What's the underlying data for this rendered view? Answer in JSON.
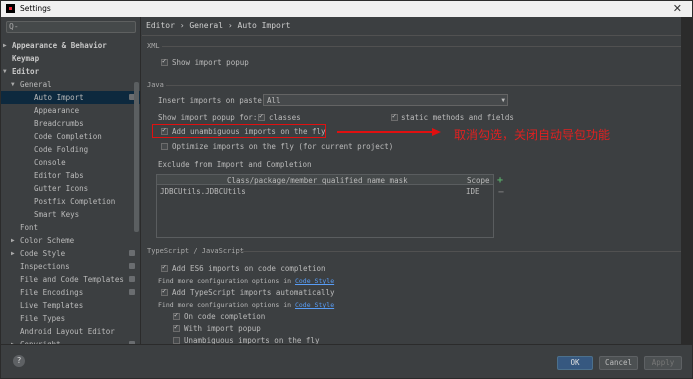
{
  "window": {
    "title": "Settings"
  },
  "search": {
    "placeholder": "Q-"
  },
  "tree": [
    {
      "label": "Appearance & Behavior",
      "level": 0,
      "arrow": "▶",
      "bold": true
    },
    {
      "label": "Keymap",
      "level": 0,
      "arrow": "",
      "bold": true
    },
    {
      "label": "Editor",
      "level": 0,
      "arrow": "▼",
      "bold": true
    },
    {
      "label": "General",
      "level": 1,
      "arrow": "▼"
    },
    {
      "label": "Auto Import",
      "level": 2,
      "arrow": "",
      "selected": true,
      "icon": true
    },
    {
      "label": "Appearance",
      "level": 2,
      "arrow": ""
    },
    {
      "label": "Breadcrumbs",
      "level": 2,
      "arrow": ""
    },
    {
      "label": "Code Completion",
      "level": 2,
      "arrow": ""
    },
    {
      "label": "Code Folding",
      "level": 2,
      "arrow": ""
    },
    {
      "label": "Console",
      "level": 2,
      "arrow": ""
    },
    {
      "label": "Editor Tabs",
      "level": 2,
      "arrow": ""
    },
    {
      "label": "Gutter Icons",
      "level": 2,
      "arrow": ""
    },
    {
      "label": "Postfix Completion",
      "level": 2,
      "arrow": ""
    },
    {
      "label": "Smart Keys",
      "level": 2,
      "arrow": ""
    },
    {
      "label": "Font",
      "level": 1,
      "arrow": ""
    },
    {
      "label": "Color Scheme",
      "level": 1,
      "arrow": "▶"
    },
    {
      "label": "Code Style",
      "level": 1,
      "arrow": "▶",
      "icon": true
    },
    {
      "label": "Inspections",
      "level": 1,
      "arrow": "",
      "icon": true
    },
    {
      "label": "File and Code Templates",
      "level": 1,
      "arrow": "",
      "icon": true
    },
    {
      "label": "File Encodings",
      "level": 1,
      "arrow": "",
      "icon": true
    },
    {
      "label": "Live Templates",
      "level": 1,
      "arrow": ""
    },
    {
      "label": "File Types",
      "level": 1,
      "arrow": ""
    },
    {
      "label": "Android Layout Editor",
      "level": 1,
      "arrow": ""
    },
    {
      "label": "Copyright",
      "level": 1,
      "arrow": "▶",
      "icon": true
    }
  ],
  "breadcrumb": "Editor › General › Auto Import",
  "xml": {
    "title": "XML",
    "show_import_popup": "Show import popup"
  },
  "java": {
    "title": "Java",
    "insert_label": "Insert imports on paste:",
    "insert_value": "All",
    "show_popup_label": "Show import popup for:",
    "classes": "classes",
    "static_methods": "static methods and fields",
    "add_unambiguous": "Add unambiguous imports on the fly",
    "optimize": "Optimize imports on the fly (for current project)",
    "exclude_title": "Exclude from Import and Completion",
    "table_header": [
      "Class/package/member qualified name mask",
      "Scope"
    ],
    "table_rows": [
      {
        "name": "JDBCUtils.JDBCUtils",
        "scope": "IDE"
      }
    ]
  },
  "annotation": "取消勾选，关闭自动导包功能",
  "ts": {
    "title": "TypeScript / JavaScript",
    "add_es6": "Add ES6 imports on code completion",
    "more_config_1": "Find more configuration options in",
    "code_style_link": "Code Style",
    "add_ts": "Add TypeScript imports automatically",
    "more_config_2": "Find more configuration options in",
    "on_completion": "On code completion",
    "with_popup": "With import popup",
    "unambiguous": "Unambiguous imports on the fly"
  },
  "buttons": {
    "ok": "OK",
    "cancel": "Cancel",
    "apply": "Apply",
    "help": "?"
  },
  "colors": {
    "accent": "#365880",
    "annotation": "#e01010",
    "selection": "#0d293e"
  }
}
